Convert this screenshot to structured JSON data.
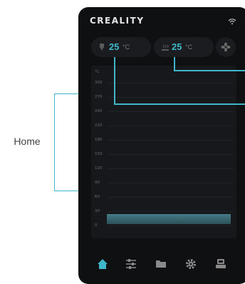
{
  "left_label": "Home",
  "device": {
    "brand": "CREALITY",
    "status_icons": [
      "wifi-icon"
    ],
    "temperatures": {
      "nozzle": {
        "icon": "nozzle-icon",
        "value": "25",
        "unit": "°C"
      },
      "bed": {
        "icon": "bed-icon",
        "value": "25",
        "unit": "°C"
      },
      "fan": {
        "icon": "fan-icon"
      }
    },
    "chart": {
      "unit_label": "°C",
      "tick_labels": [
        "300",
        "270",
        "240",
        "210",
        "180",
        "150",
        "120",
        "90",
        "60",
        "30",
        "0"
      ]
    },
    "bottom_nav": [
      {
        "icon": "home-icon",
        "active": true
      },
      {
        "icon": "adjust-icon",
        "active": false
      },
      {
        "icon": "folder-icon",
        "active": false
      },
      {
        "icon": "settings-icon",
        "active": false
      },
      {
        "icon": "printer-icon",
        "active": false
      }
    ]
  },
  "colors": {
    "accent": "#3fb6c9",
    "panel": "#0f1012",
    "card": "#1b1c1f"
  }
}
